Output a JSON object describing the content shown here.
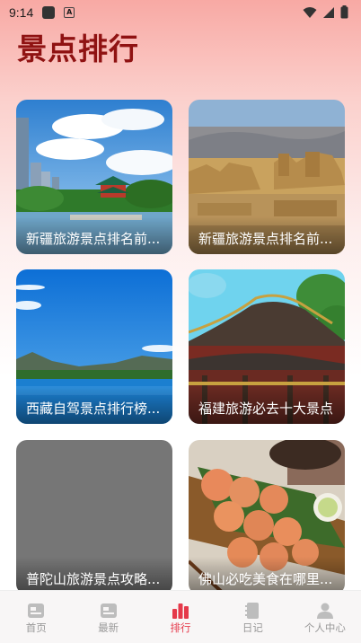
{
  "status_bar": {
    "time": "9:14",
    "icons": [
      "notification-square-icon",
      "a-badge-icon",
      "wifi-icon",
      "signal-icon",
      "battery-icon"
    ]
  },
  "page": {
    "title": "景点排行"
  },
  "cards": [
    {
      "caption": "新疆旅游景点排名前...",
      "image": "city-park-pagoda-lake"
    },
    {
      "caption": "新疆旅游景点排名前...",
      "image": "desert-ancient-ruins"
    },
    {
      "caption": "西藏自驾景点排行榜...",
      "image": "blue-lake-mountains"
    },
    {
      "caption": "福建旅游必去十大景点",
      "image": "chinese-temple-roof"
    },
    {
      "caption": "普陀山旅游景点攻略...",
      "image": "gray-placeholder"
    },
    {
      "caption": "佛山必吃美食在哪里...",
      "image": "fried-shrimp-cakes"
    }
  ],
  "tabbar": {
    "tabs": [
      {
        "label": "首页",
        "icon": "home-card-icon",
        "active": false
      },
      {
        "label": "最新",
        "icon": "news-card-icon",
        "active": false
      },
      {
        "label": "排行",
        "icon": "ranking-bars-icon",
        "active": true
      },
      {
        "label": "日记",
        "icon": "diary-book-icon",
        "active": false
      },
      {
        "label": "个人中心",
        "icon": "user-person-icon",
        "active": false
      }
    ]
  },
  "colors": {
    "title": "#8f1212",
    "active_tab": "#e5394a",
    "inactive_tab": "#9a9a9a"
  }
}
